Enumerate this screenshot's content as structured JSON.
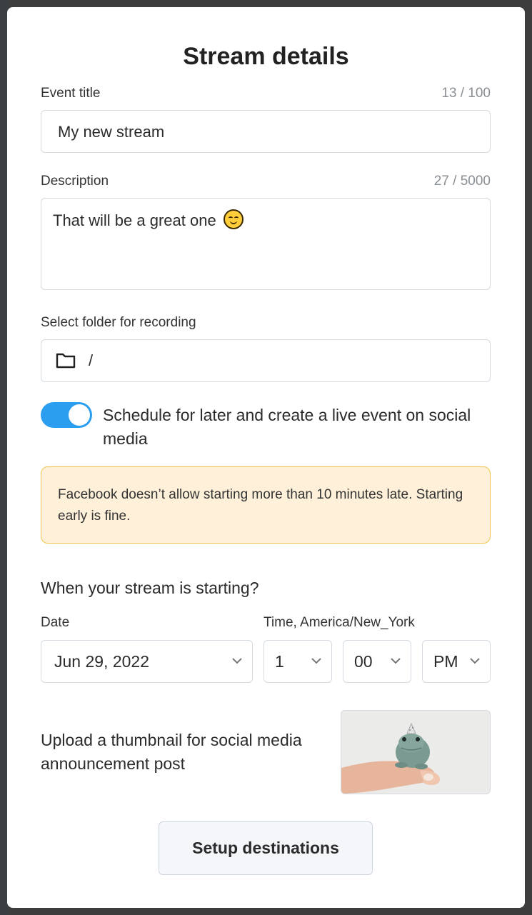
{
  "dialog": {
    "title": "Stream details"
  },
  "event_title": {
    "label": "Event title",
    "counter": "13 / 100",
    "value": "My new stream"
  },
  "description": {
    "label": "Description",
    "counter": "27 / 5000",
    "value": "That will be a great one",
    "emoji": "smiling-face-icon"
  },
  "folder": {
    "label": "Select folder for recording",
    "icon": "folder-icon",
    "value": "/"
  },
  "schedule": {
    "toggle_on": true,
    "label": "Schedule for later and create a live event on social media"
  },
  "notice": {
    "text": "Facebook doesn’t allow starting more than 10 minutes late. Starting early is fine."
  },
  "start": {
    "question": "When your stream is starting?",
    "date_label": "Date",
    "time_label": "Time, America/New_York",
    "date_value": "Jun 29, 2022",
    "hour_value": "1",
    "minute_value": "00",
    "ampm_value": "PM"
  },
  "thumbnail": {
    "label": "Upload a thumbnail for social media announcement post"
  },
  "actions": {
    "setup_label": "Setup destinations"
  },
  "colors": {
    "accent": "#2b9ef0",
    "notice_bg": "#fff1d9",
    "notice_border": "#f0c44a"
  }
}
